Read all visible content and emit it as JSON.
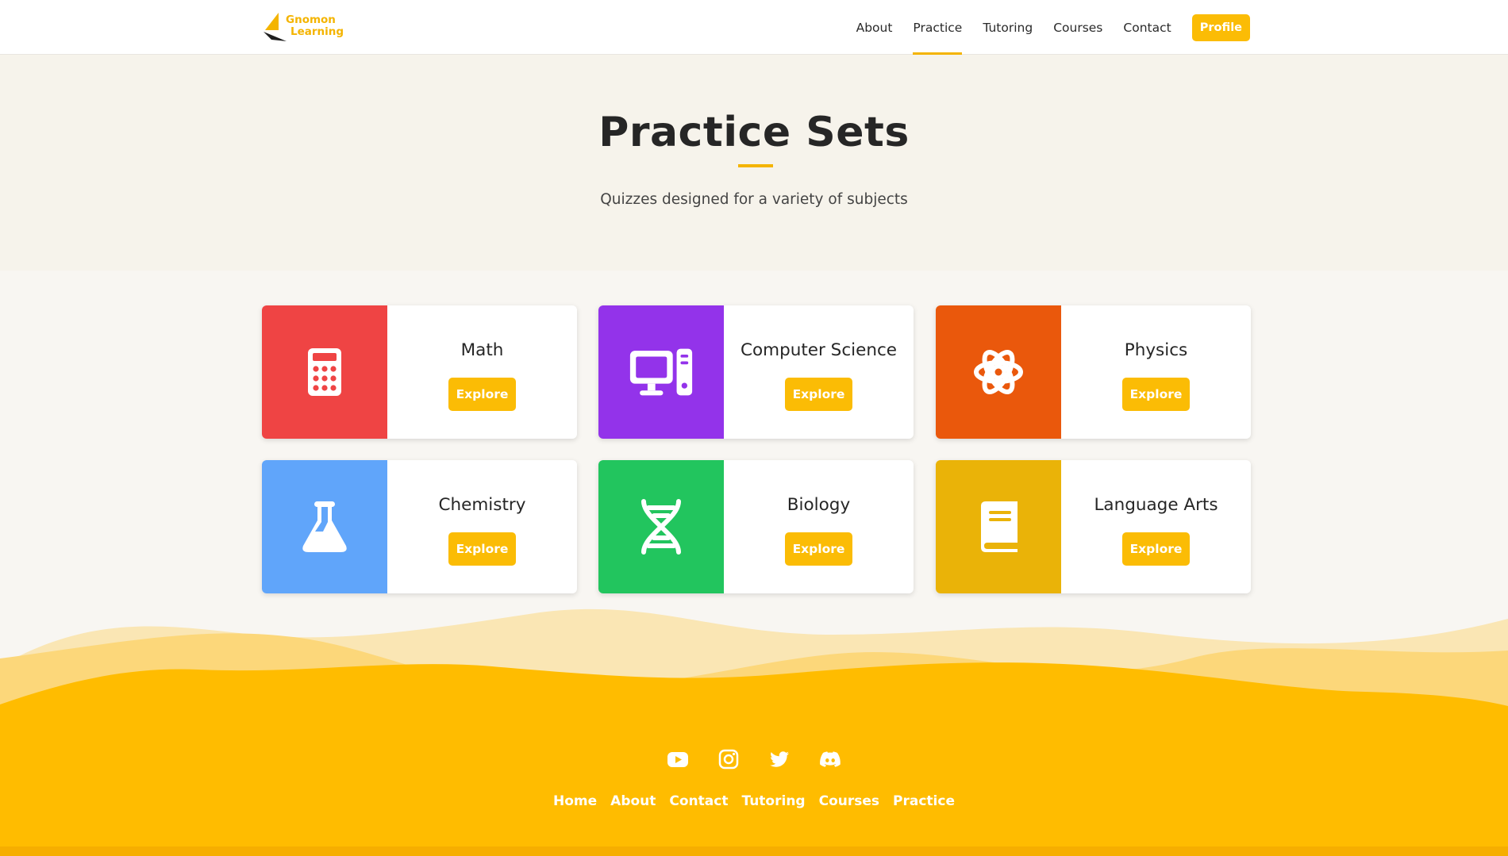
{
  "brand": {
    "line1": "Gnomon",
    "line2": "Learning",
    "color": "#f4b400"
  },
  "nav": {
    "links": [
      "About",
      "Practice",
      "Tutoring",
      "Courses",
      "Contact"
    ],
    "active": "Practice",
    "profile_label": "Profile"
  },
  "hero": {
    "title": "Practice Sets",
    "subtitle": "Quizzes designed for a variety of subjects"
  },
  "subjects": [
    {
      "name": "Math",
      "color": "#ef4444",
      "icon": "calculator-icon",
      "button": "Explore"
    },
    {
      "name": "Computer Science",
      "color": "#9333ea",
      "icon": "computer-icon",
      "button": "Explore"
    },
    {
      "name": "Physics",
      "color": "#ea580c",
      "icon": "atom-icon",
      "button": "Explore"
    },
    {
      "name": "Chemistry",
      "color": "#60a5fa",
      "icon": "flask-icon",
      "button": "Explore"
    },
    {
      "name": "Biology",
      "color": "#22c55e",
      "icon": "dna-icon",
      "button": "Explore"
    },
    {
      "name": "Language Arts",
      "color": "#eab308",
      "icon": "book-icon",
      "button": "Explore"
    }
  ],
  "footer": {
    "social": [
      "youtube-icon",
      "instagram-icon",
      "twitter-icon",
      "discord-icon"
    ],
    "links": [
      "Home",
      "About",
      "Contact",
      "Tutoring",
      "Courses",
      "Practice"
    ],
    "accent": "#fbbc05"
  }
}
